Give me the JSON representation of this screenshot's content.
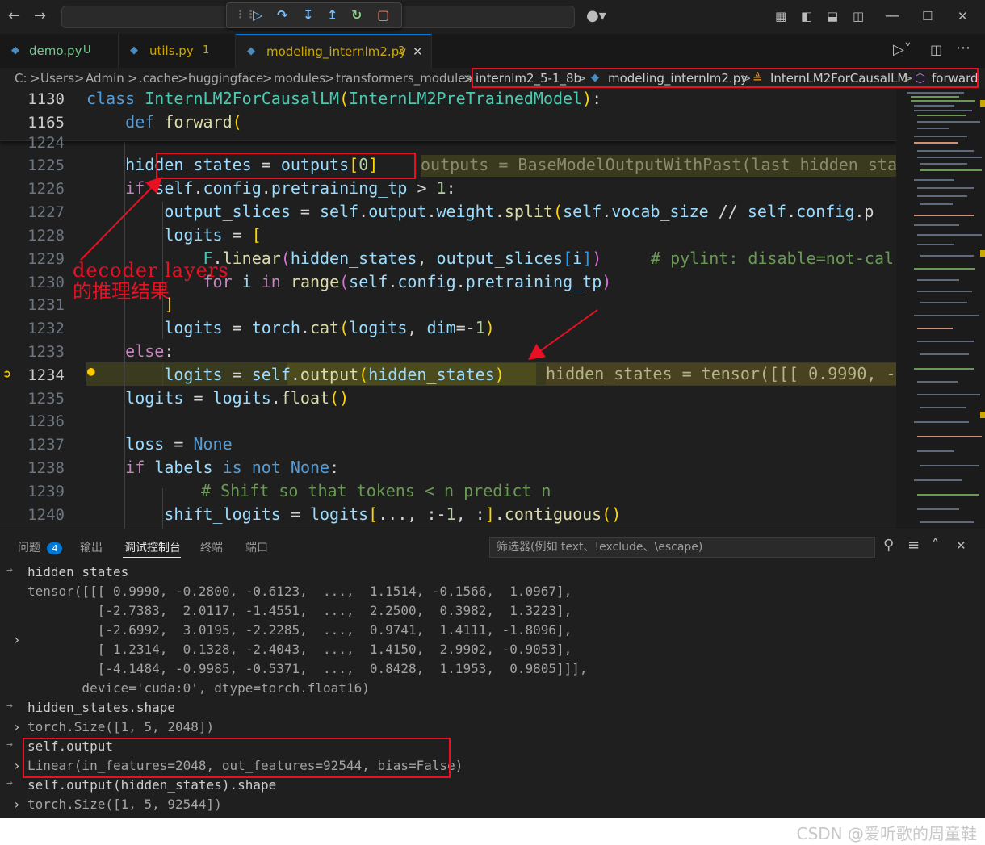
{
  "title_bar": {
    "back_icon": "arrow-left-icon",
    "forward_icon": "arrow-right-icon",
    "debug_toolbar": [
      "drag-handle-icon",
      "continue-icon",
      "step-over-icon",
      "step-into-icon",
      "step-out-icon",
      "restart-icon",
      "stop-icon"
    ],
    "copilot_icon": "copilot-icon",
    "layout_icons": [
      "customize-layout-icon",
      "toggle-primary-sidebar-icon",
      "toggle-panel-icon",
      "toggle-secondary-sidebar-icon"
    ],
    "window_controls": [
      "minimize-icon",
      "maximize-icon",
      "close-icon"
    ],
    "window_controls_glyphs": {
      "minimize": "—",
      "maximize": "☐",
      "close": "✕"
    }
  },
  "tabs": [
    {
      "name": "demo.py",
      "badge": "U",
      "badge_color": "#73c991"
    },
    {
      "name": "utils.py",
      "badge": "1",
      "badge_color": "#cca700"
    },
    {
      "name": "modeling_internlm2.py",
      "badge": "3",
      "badge_color": "#cca700",
      "active": true
    }
  ],
  "tab_close": "✕",
  "editor_actions": [
    "run-icon",
    "split-editor-icon",
    "more-actions-icon"
  ],
  "breadcrumb": {
    "items": [
      "C:",
      "Users",
      "Admin",
      ".cache",
      "huggingface",
      "modules",
      "transformers_modules"
    ],
    "highlighted": [
      "internlm2_5-1_8b",
      "modeling_internlm2.py",
      "InternLM2ForCausalLM",
      "forward"
    ],
    "sep": ">"
  },
  "editor": {
    "sticky": [
      {
        "line": "1130"
      },
      {
        "line": "1165"
      }
    ],
    "line_numbers": [
      "1224",
      "1225",
      "1226",
      "1227",
      "1228",
      "1229",
      "1230",
      "1231",
      "1232",
      "1233",
      "1234",
      "1235",
      "1236",
      "1237",
      "1238",
      "1239",
      "1240"
    ],
    "current_line": "1234",
    "inline_value_1225": "outputs = BaseModelOutputWithPast(last_hidden_stat",
    "inline_value_1234": "hidden_states = tensor([[[ 0.9990, -0",
    "comment_1229": "# pylint: disable=not-cal",
    "comment_1239": "# Shift so that tokens < n predict n"
  },
  "annotations": {
    "decoder_label_line1": "decoder layers",
    "decoder_label_line2": "的推理结果"
  },
  "panel": {
    "tabs": [
      {
        "label": "问题",
        "count": "4"
      },
      {
        "label": "输出"
      },
      {
        "label": "调试控制台",
        "active": true
      },
      {
        "label": "终端"
      },
      {
        "label": "端口"
      }
    ],
    "filter_placeholder": "筛选器(例如 text、!exclude、\\escape)",
    "actions": [
      "search-icon",
      "clear-console-icon",
      "maximize-panel-icon",
      "close-panel-icon"
    ],
    "console": [
      {
        "kind": "input",
        "text": "hidden_states"
      },
      {
        "kind": "output",
        "text": "tensor([[[ 0.9990, -0.2800, -0.6123,  ...,  1.1514, -0.1566,  1.0967],"
      },
      {
        "kind": "output",
        "text": "         [-2.7383,  2.0117, -1.4551,  ...,  2.2500,  0.3982,  1.3223],"
      },
      {
        "kind": "output",
        "text": "         [-2.6992,  3.0195, -2.2285,  ...,  0.9741,  1.4111, -1.8096],"
      },
      {
        "kind": "output",
        "text": "         [ 1.2314,  0.1328, -2.4043,  ...,  1.4150,  2.9902, -0.9053],"
      },
      {
        "kind": "output",
        "text": "         [-4.1484, -0.9985, -0.5371,  ...,  0.8428,  1.1953,  0.9805]]],"
      },
      {
        "kind": "output",
        "text": "       device='cuda:0', dtype=torch.float16)"
      },
      {
        "kind": "input",
        "text": "hidden_states.shape"
      },
      {
        "kind": "output",
        "text": "torch.Size([1, 5, 2048])"
      },
      {
        "kind": "input",
        "text": "self.output"
      },
      {
        "kind": "output",
        "text": "Linear(in_features=2048, out_features=92544, bias=False)"
      },
      {
        "kind": "input",
        "text": "self.output(hidden_states).shape"
      },
      {
        "kind": "output",
        "text": "torch.Size([1, 5, 92544])"
      }
    ]
  },
  "watermark": "CSDN @爱听歌的周童鞋",
  "colors": {
    "annotation_red": "#e81123",
    "accent": "#0078d4"
  }
}
